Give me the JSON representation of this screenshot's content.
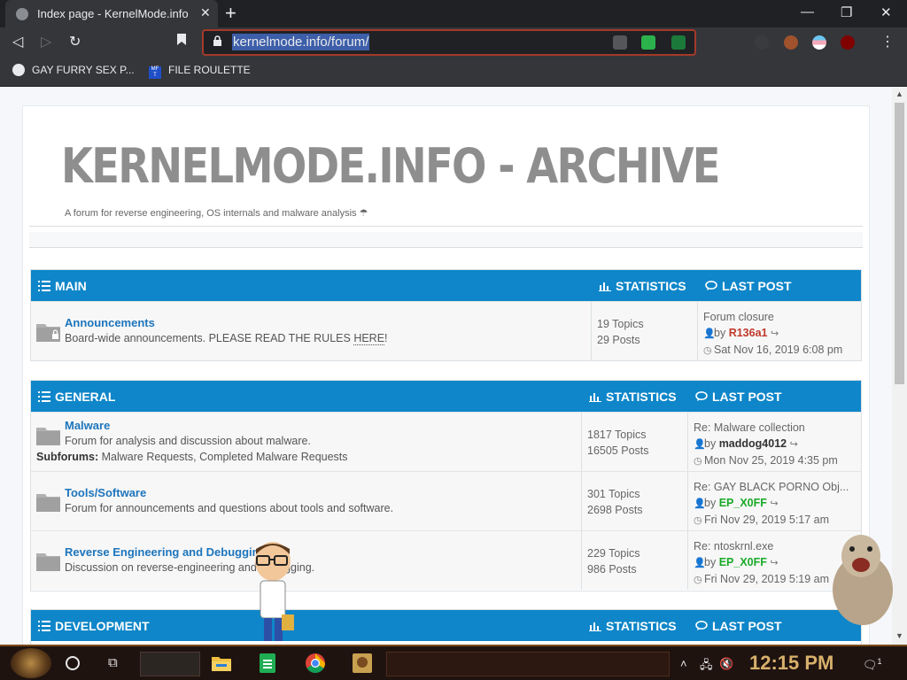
{
  "browser": {
    "tab_title": "Index page - KernelMode.info",
    "url_selected": "kernelmode.info/forum/",
    "bookmarks": [
      "GAY FURRY SEX P...",
      "FILE ROULETTE"
    ],
    "bookmark_icon_label": "MF\nT"
  },
  "page": {
    "site_title": "KERNELMODE.INFO - ARCHIVE",
    "site_description": "A forum for reverse engineering, OS internals and malware analysis",
    "umbrella_glyph": "☂"
  },
  "sections": [
    {
      "name": "MAIN",
      "stats_header": "STATISTICS",
      "lastpost_header": "LAST POST",
      "forums": [
        {
          "title": "Announcements",
          "description_prefix": "Board-wide announcements. PLEASE READ THE RULES ",
          "description_link": "HERE",
          "description_suffix": "!",
          "topics": "19 Topics",
          "posts": "29 Posts",
          "last_title": "Forum closure",
          "by": "by",
          "last_user": "R136a1",
          "last_date": "Sat Nov 16, 2019 6:08 pm"
        }
      ]
    },
    {
      "name": "GENERAL",
      "stats_header": "STATISTICS",
      "lastpost_header": "LAST POST",
      "forums": [
        {
          "title": "Malware",
          "description": "Forum for analysis and discussion about malware.",
          "subforums_label": "Subforums:",
          "subforums": "Malware Requests, Completed Malware Requests",
          "topics": "1817 Topics",
          "posts": "16505 Posts",
          "last_title": "Re: Malware collection",
          "by": "by",
          "last_user": "maddog4012",
          "last_date": "Mon Nov 25, 2019 4:35 pm"
        },
        {
          "title": "Tools/Software",
          "description": "Forum for announcements and questions about tools and software.",
          "topics": "301 Topics",
          "posts": "2698 Posts",
          "last_title": "Re: GAY BLACK PORNO Obj...",
          "by": "by",
          "last_user": "EP_X0FF",
          "last_date": "Fri Nov 29, 2019 5:17 am"
        },
        {
          "title": "Reverse Engineering and Debugging",
          "description": "Discussion on reverse-engineering and debugging.",
          "topics": "229 Topics",
          "posts": "986 Posts",
          "last_title": "Re: ntoskrnl.exe",
          "by": "by",
          "last_user": "EP_X0FF",
          "last_date": "Fri Nov 29, 2019 5:19 am"
        }
      ]
    },
    {
      "name": "DEVELOPMENT",
      "stats_header": "STATISTICS",
      "lastpost_header": "LAST POST",
      "forums": []
    }
  ],
  "taskbar": {
    "clock": "12:15 PM",
    "notification_count": "1"
  },
  "colors": {
    "accent": "#0e86c9",
    "link": "#1d75bc",
    "user_red": "#c0392b",
    "user_green": "#1aa928"
  }
}
